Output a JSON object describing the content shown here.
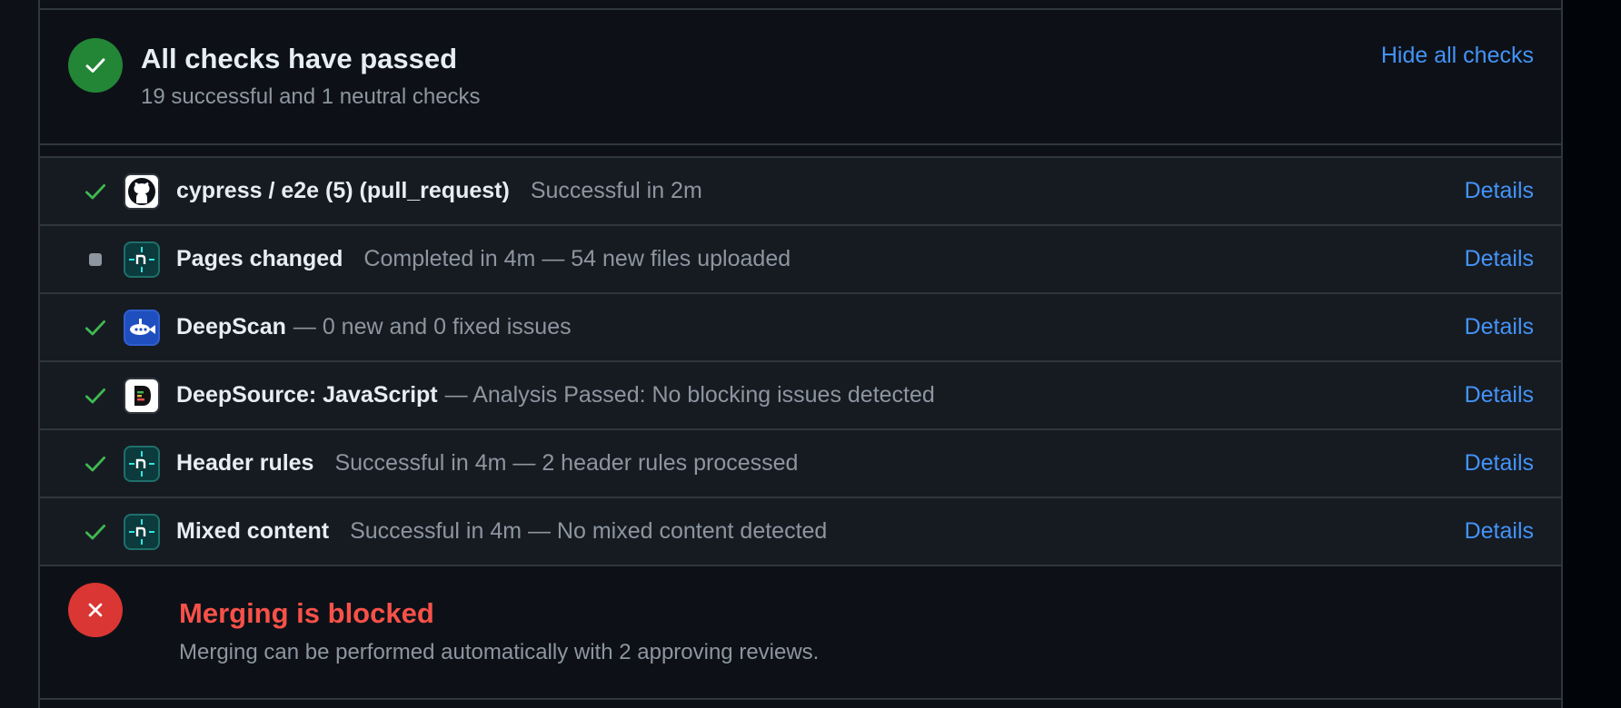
{
  "summary": {
    "title": "All checks have passed",
    "subtitle": "19 successful and 1 neutral checks",
    "hide_link": "Hide all checks"
  },
  "checks": [
    {
      "name": "cypress / e2e (5) (pull_request)",
      "desc": "Successful in 2m",
      "status": "success",
      "icon": "github-icon",
      "sep": "gap",
      "details": "Details"
    },
    {
      "name": "Pages changed",
      "desc": "Completed in 4m — 54 new files uploaded",
      "status": "neutral",
      "icon": "netlify-icon",
      "sep": "gap",
      "details": "Details"
    },
    {
      "name": "DeepScan",
      "desc": "— 0 new and 0 fixed issues",
      "status": "success",
      "icon": "deepscan-icon",
      "sep": "small",
      "details": "Details"
    },
    {
      "name": "DeepSource: JavaScript",
      "desc": "— Analysis Passed: No blocking issues detected",
      "status": "success",
      "icon": "deepsource-icon",
      "sep": "small",
      "details": "Details"
    },
    {
      "name": "Header rules",
      "desc": "Successful in 4m — 2 header rules processed",
      "status": "success",
      "icon": "netlify-icon",
      "sep": "gap",
      "details": "Details"
    },
    {
      "name": "Mixed content",
      "desc": "Successful in 4m — No mixed content detected",
      "status": "success",
      "icon": "netlify-icon",
      "sep": "gap",
      "details": "Details"
    }
  ],
  "merge": {
    "title": "Merging is blocked",
    "subtitle": "Merging can be performed automatically with 2 approving reviews."
  },
  "colors": {
    "success": "#3fb950",
    "neutral": "#8d96a0",
    "link": "#4493f8",
    "danger": "#f85149"
  }
}
